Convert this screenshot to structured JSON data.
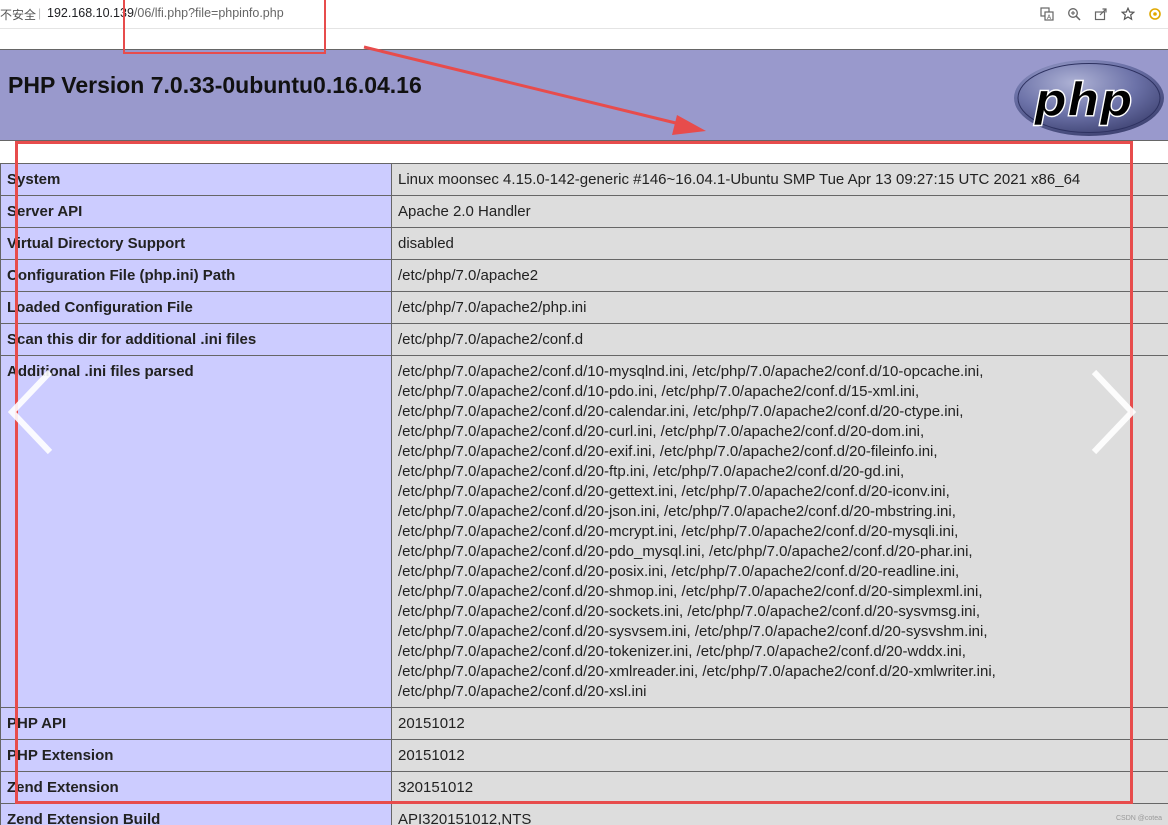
{
  "browser": {
    "security_label": "不安全",
    "url_host": "192.168.10.139",
    "url_path": "/06/lfi.php?file=phpinfo.php",
    "tool_icons": [
      "translate-icon",
      "zoom-icon",
      "share-icon",
      "bookmark-star-icon",
      "extension-icon"
    ]
  },
  "header": {
    "title": "PHP Version 7.0.33-0ubuntu0.16.04.16",
    "logo_text": "php"
  },
  "rows": [
    {
      "key": "System",
      "lines": [
        "Linux moonsec 4.15.0-142-generic #146~16.04.1-Ubuntu SMP Tue Apr 13 09:27:15 UTC 2021 x86_64"
      ]
    },
    {
      "key": "Server API",
      "lines": [
        "Apache 2.0 Handler"
      ]
    },
    {
      "key": "Virtual Directory Support",
      "lines": [
        "disabled"
      ]
    },
    {
      "key": "Configuration File (php.ini) Path",
      "lines": [
        "/etc/php/7.0/apache2"
      ]
    },
    {
      "key": "Loaded Configuration File",
      "lines": [
        "/etc/php/7.0/apache2/php.ini"
      ]
    },
    {
      "key": "Scan this dir for additional .ini files",
      "lines": [
        "/etc/php/7.0/apache2/conf.d"
      ]
    },
    {
      "key": "Additional .ini files parsed",
      "lines": [
        "/etc/php/7.0/apache2/conf.d/10-mysqlnd.ini, /etc/php/7.0/apache2/conf.d/10-opcache.ini,",
        "/etc/php/7.0/apache2/conf.d/10-pdo.ini, /etc/php/7.0/apache2/conf.d/15-xml.ini,",
        "/etc/php/7.0/apache2/conf.d/20-calendar.ini, /etc/php/7.0/apache2/conf.d/20-ctype.ini,",
        "/etc/php/7.0/apache2/conf.d/20-curl.ini, /etc/php/7.0/apache2/conf.d/20-dom.ini,",
        "/etc/php/7.0/apache2/conf.d/20-exif.ini, /etc/php/7.0/apache2/conf.d/20-fileinfo.ini,",
        "/etc/php/7.0/apache2/conf.d/20-ftp.ini, /etc/php/7.0/apache2/conf.d/20-gd.ini,",
        "/etc/php/7.0/apache2/conf.d/20-gettext.ini, /etc/php/7.0/apache2/conf.d/20-iconv.ini,",
        "/etc/php/7.0/apache2/conf.d/20-json.ini, /etc/php/7.0/apache2/conf.d/20-mbstring.ini,",
        "/etc/php/7.0/apache2/conf.d/20-mcrypt.ini, /etc/php/7.0/apache2/conf.d/20-mysqli.ini,",
        "/etc/php/7.0/apache2/conf.d/20-pdo_mysql.ini, /etc/php/7.0/apache2/conf.d/20-phar.ini,",
        "/etc/php/7.0/apache2/conf.d/20-posix.ini, /etc/php/7.0/apache2/conf.d/20-readline.ini,",
        "/etc/php/7.0/apache2/conf.d/20-shmop.ini, /etc/php/7.0/apache2/conf.d/20-simplexml.ini,",
        "/etc/php/7.0/apache2/conf.d/20-sockets.ini, /etc/php/7.0/apache2/conf.d/20-sysvmsg.ini,",
        "/etc/php/7.0/apache2/conf.d/20-sysvsem.ini, /etc/php/7.0/apache2/conf.d/20-sysvshm.ini,",
        "/etc/php/7.0/apache2/conf.d/20-tokenizer.ini, /etc/php/7.0/apache2/conf.d/20-wddx.ini,",
        "/etc/php/7.0/apache2/conf.d/20-xmlreader.ini, /etc/php/7.0/apache2/conf.d/20-xmlwriter.ini,",
        "/etc/php/7.0/apache2/conf.d/20-xsl.ini"
      ]
    },
    {
      "key": "PHP API",
      "lines": [
        "20151012"
      ]
    },
    {
      "key": "PHP Extension",
      "lines": [
        "20151012"
      ]
    },
    {
      "key": "Zend Extension",
      "lines": [
        "320151012"
      ]
    },
    {
      "key": "Zend Extension Build",
      "lines": [
        "API320151012,NTS"
      ]
    }
  ],
  "colors": {
    "header_bg": "#9999cc",
    "key_bg": "#ccccff",
    "value_bg": "#dddddd",
    "annotation": "#e74c4c"
  },
  "watermark": "CSDN @cotea"
}
